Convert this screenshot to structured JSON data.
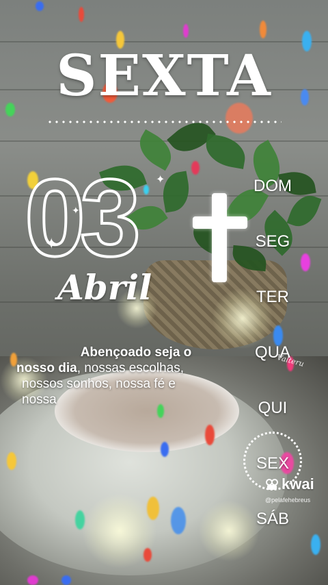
{
  "header": {
    "day_name": "SEXTA"
  },
  "date": {
    "day_number": "03",
    "month": "Abril"
  },
  "weekdays": [
    "DOM",
    "SEG",
    "TER",
    "QUA",
    "QUI",
    "SEX",
    "SÁB"
  ],
  "selected_weekday": "SEX",
  "message": {
    "bold_part1": "Abençoado seja o",
    "bold_part2": "nosso dia",
    "rest_line2": ", nossas escolhas,",
    "line3": "nossos sonhos, nossa fé e",
    "line4": "nossa"
  },
  "signature": "Valteru",
  "watermark": {
    "brand": "kwai",
    "handle": "@pelafehebreus"
  },
  "colors": {
    "text": "#ffffff",
    "leaf": "#2f6a2c"
  }
}
